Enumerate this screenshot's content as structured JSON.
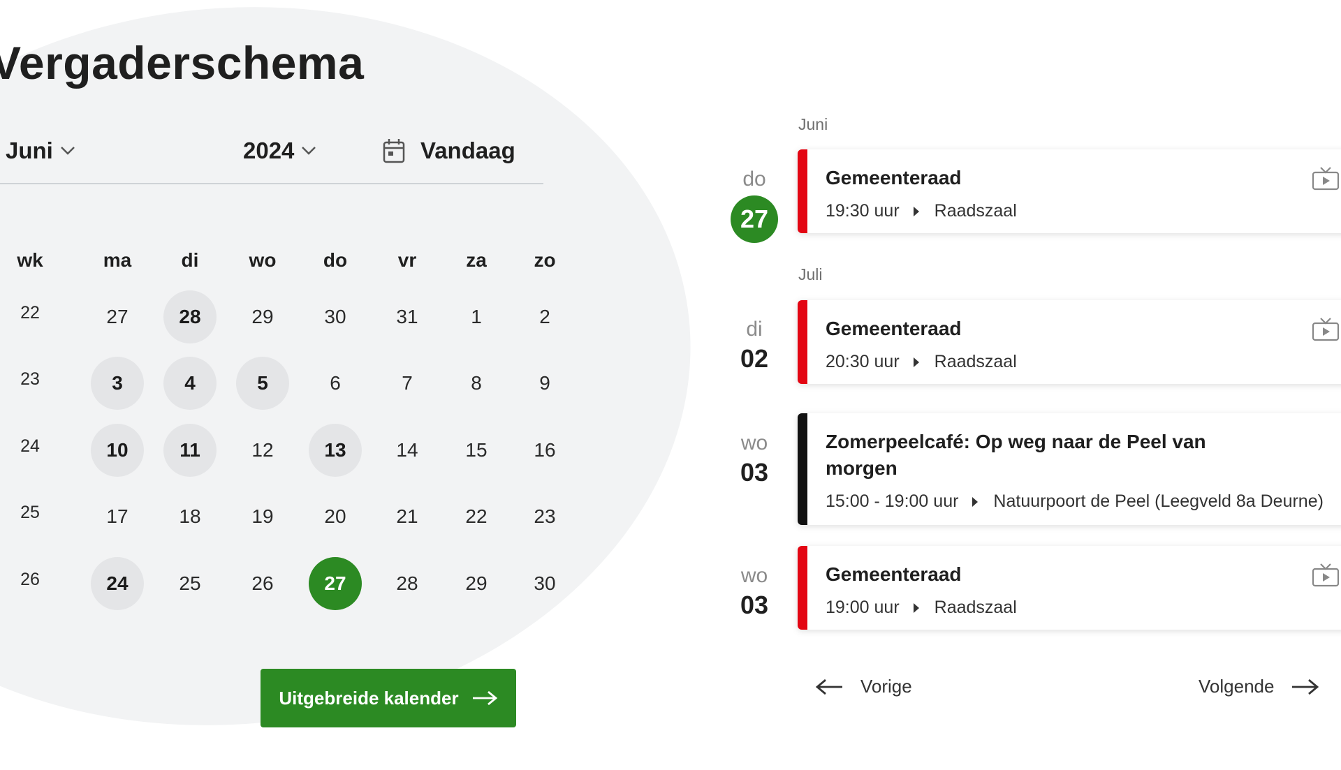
{
  "page_title": "Vergaderschema",
  "selectors": {
    "month": "Juni",
    "year": "2024",
    "today": "Vandaag"
  },
  "calendar": {
    "headers": [
      "wk",
      "ma",
      "di",
      "wo",
      "do",
      "vr",
      "za",
      "zo"
    ],
    "weeks": [
      {
        "wk": "22",
        "days": [
          {
            "d": "27",
            "m": false
          },
          {
            "d": "28",
            "m": true
          },
          {
            "d": "29",
            "m": false
          },
          {
            "d": "30",
            "m": false
          },
          {
            "d": "31",
            "m": false
          },
          {
            "d": "1",
            "m": false
          },
          {
            "d": "2",
            "m": false
          }
        ]
      },
      {
        "wk": "23",
        "days": [
          {
            "d": "3",
            "m": true
          },
          {
            "d": "4",
            "m": true
          },
          {
            "d": "5",
            "m": true
          },
          {
            "d": "6",
            "m": false
          },
          {
            "d": "7",
            "m": false
          },
          {
            "d": "8",
            "m": false
          },
          {
            "d": "9",
            "m": false
          }
        ]
      },
      {
        "wk": "24",
        "days": [
          {
            "d": "10",
            "m": true
          },
          {
            "d": "11",
            "m": true
          },
          {
            "d": "12",
            "m": false
          },
          {
            "d": "13",
            "m": true
          },
          {
            "d": "14",
            "m": false
          },
          {
            "d": "15",
            "m": false
          },
          {
            "d": "16",
            "m": false
          }
        ]
      },
      {
        "wk": "25",
        "days": [
          {
            "d": "17",
            "m": false
          },
          {
            "d": "18",
            "m": false
          },
          {
            "d": "19",
            "m": false
          },
          {
            "d": "20",
            "m": false
          },
          {
            "d": "21",
            "m": false
          },
          {
            "d": "22",
            "m": false
          },
          {
            "d": "23",
            "m": false
          }
        ]
      },
      {
        "wk": "26",
        "days": [
          {
            "d": "24",
            "m": true
          },
          {
            "d": "25",
            "m": false
          },
          {
            "d": "26",
            "m": false
          },
          {
            "d": "27",
            "m": false,
            "today": true
          },
          {
            "d": "28",
            "m": false
          },
          {
            "d": "29",
            "m": false
          },
          {
            "d": "30",
            "m": false
          }
        ]
      }
    ]
  },
  "extended_button": "Uitgebreide kalender",
  "agenda": {
    "months": [
      "Juni",
      "Juli"
    ],
    "events": [
      {
        "dow": "do",
        "day": "27",
        "title": "Gemeenteraad",
        "time": "19:30 uur",
        "location": "Raadszaal",
        "stream": true
      },
      {
        "dow": "di",
        "day": "02",
        "title": "Gemeenteraad",
        "time": "20:30 uur",
        "location": "Raadszaal",
        "stream": true
      },
      {
        "dow": "wo",
        "day": "03",
        "title": "Zomerpeelcafé: Op weg naar de Peel van morgen",
        "time": "15:00 - 19:00 uur",
        "location": "Natuurpoort de Peel (Leegveld 8a Deurne)",
        "stream": false
      },
      {
        "dow": "wo",
        "day": "03",
        "title": "Gemeenteraad",
        "time": "19:00 uur",
        "location": "Raadszaal",
        "stream": true
      }
    ]
  },
  "pager": {
    "prev": "Vorige",
    "next": "Volgende"
  },
  "colors": {
    "accent_green": "#2c8a23",
    "meeting_red": "#e30613",
    "event_black": "#111111",
    "blob_gray": "#f2f3f4"
  },
  "icons": {
    "dropdown": "chevron-down-icon",
    "today": "calendar-icon",
    "arrow_right": "arrow-right-icon",
    "arrow_left": "arrow-left-icon",
    "stream": "tv-icon",
    "separator": "caret-right-icon"
  }
}
